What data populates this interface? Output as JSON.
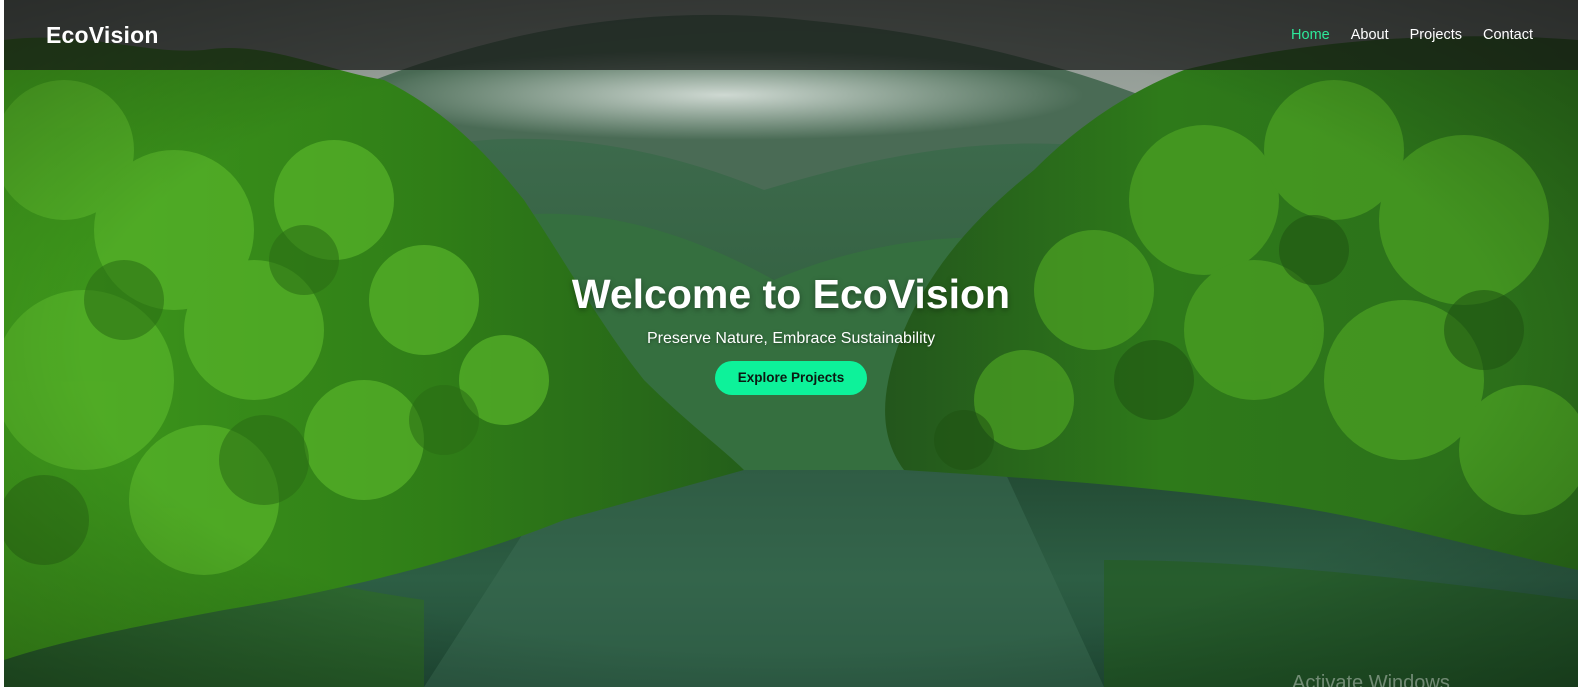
{
  "brand": {
    "logo_text": "EcoVision"
  },
  "nav": {
    "items": [
      {
        "label": "Home",
        "active": true
      },
      {
        "label": "About",
        "active": false
      },
      {
        "label": "Projects",
        "active": false
      },
      {
        "label": "Contact",
        "active": false
      }
    ]
  },
  "hero": {
    "title": "Welcome to EcoVision",
    "subtitle": "Preserve Nature, Embrace Sustainability",
    "cta_label": "Explore Projects",
    "background_image": "misty-forest-river"
  },
  "overlay": {
    "watermark_text": "Activate Windows"
  },
  "colors": {
    "accent": "#0df29a",
    "nav_active": "#2de89a",
    "navbar_bg": "#161816",
    "text": "#ffffff"
  }
}
